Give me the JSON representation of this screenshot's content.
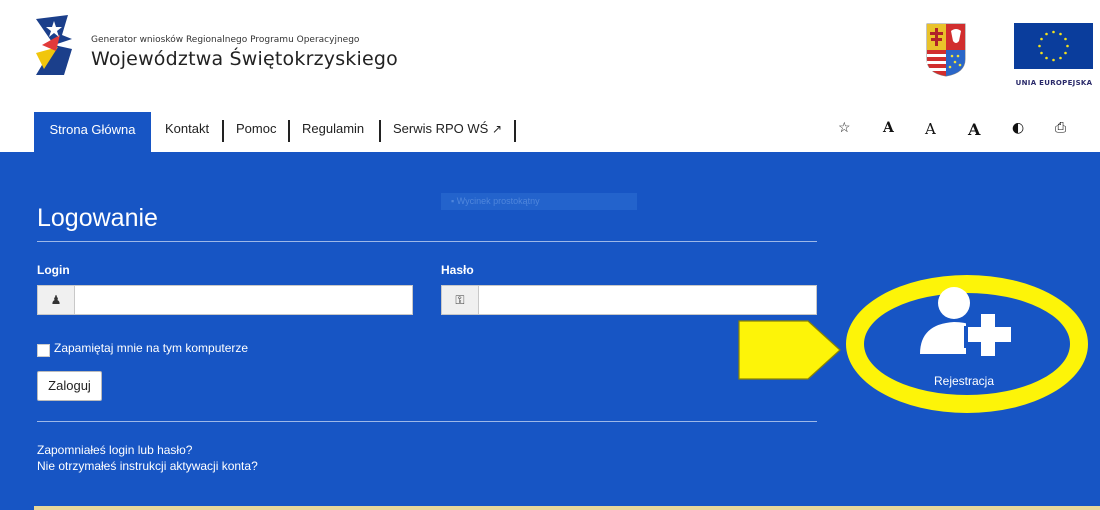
{
  "header": {
    "line1": "Generator wniosków Regionalnego Programu Operacyjnego",
    "line2": "Województwa Świętokrzyskiego",
    "eu_label": "UNIA EUROPEJSKA"
  },
  "nav": {
    "tabs": [
      {
        "label": "Strona Główna",
        "active": true
      },
      {
        "label": "Kontakt"
      },
      {
        "label": "Pomoc"
      },
      {
        "label": "Regulamin"
      },
      {
        "label": "Serwis RPO WŚ"
      }
    ],
    "tools": [
      {
        "icon": "star-plus-icon",
        "glyph": "☆"
      },
      {
        "icon": "font-size-normal-icon",
        "glyph": "A"
      },
      {
        "icon": "font-size-larger-icon",
        "glyph": "A"
      },
      {
        "icon": "font-size-largest-icon",
        "glyph": "A"
      },
      {
        "icon": "contrast-icon",
        "glyph": "◐"
      },
      {
        "icon": "print-icon",
        "glyph": "⎙"
      }
    ]
  },
  "tooltip": "Wycinek prostokątny",
  "login": {
    "title": "Logowanie",
    "login_label": "Login",
    "password_label": "Hasło",
    "remember_label": "Zapamiętaj mnie na tym komputerze",
    "submit_label": "Zaloguj",
    "forgot_label": "Zapomniałeś login lub hasło?",
    "activation_label": "Nie otrzymałeś instrukcji aktywacji konta?"
  },
  "register": {
    "label": "Rejestracja"
  },
  "colors": {
    "brand_blue": "#1755c4",
    "highlight_yellow": "#fdf408",
    "footer_line": "#e7d79a"
  }
}
